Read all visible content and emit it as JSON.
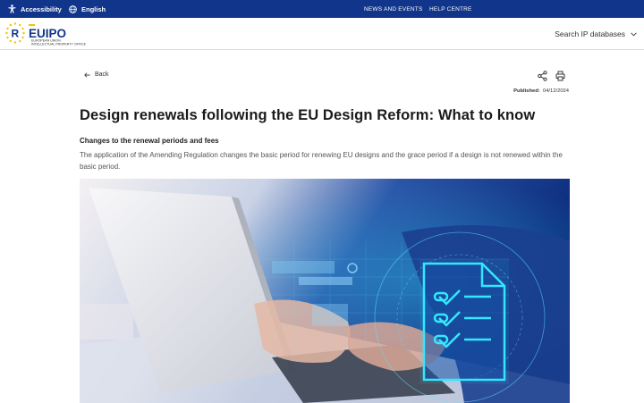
{
  "topbar": {
    "accessibility": "Accessibility",
    "language": "English",
    "links": [
      "NEWS AND EVENTS",
      "HELP CENTRE"
    ]
  },
  "header": {
    "logo_text": "EUIPO",
    "logo_sub1": "EUROPEAN UNION",
    "logo_sub2": "INTELLECTUAL PROPERTY OFFICE",
    "search_db": "Search IP databases"
  },
  "article": {
    "back": "Back",
    "published_label": "Published:",
    "published_date": "04/12/2024",
    "title": "Design renewals following the EU Design Reform: What to know",
    "subtitle": "Changes to the renewal periods and fees",
    "paragraph": "The application of the Amending Regulation changes the basic period for renewing EU designs and the grace period if a design is not renewed within the basic period."
  },
  "colors": {
    "topbar": "#10358a",
    "accent": "#f5c400",
    "text": "#1a1a1a"
  },
  "icons": [
    "accessibility-icon",
    "globe-icon",
    "chevron-down-icon",
    "arrow-left-icon",
    "share-icon",
    "print-icon"
  ]
}
